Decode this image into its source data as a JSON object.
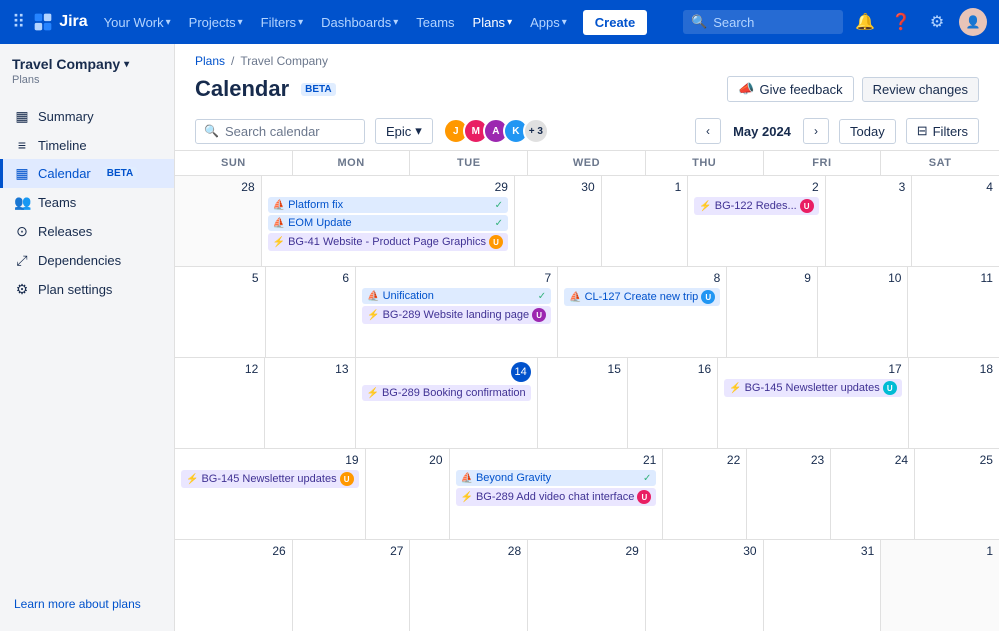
{
  "topNav": {
    "logoText": "Jira",
    "yourWork": "Your Work",
    "projects": "Projects",
    "filters": "Filters",
    "dashboards": "Dashboards",
    "teams": "Teams",
    "plans": "Plans",
    "apps": "Apps",
    "createLabel": "Create",
    "searchPlaceholder": "Search"
  },
  "breadcrumb": {
    "plans": "Plans",
    "company": "Travel Company"
  },
  "pageHeader": {
    "title": "Calendar",
    "beta": "BETA",
    "feedbackBtn": "Give feedback",
    "reviewBtn": "Review changes"
  },
  "toolbar": {
    "searchPlaceholder": "Search calendar",
    "epicLabel": "Epic",
    "monthLabel": "May 2024",
    "todayLabel": "Today",
    "filtersLabel": "Filters",
    "avatarCount": "+ 3"
  },
  "calendarHeader": {
    "days": [
      "SUN",
      "MON",
      "TUE",
      "WED",
      "THU",
      "FRI",
      "SAT"
    ]
  },
  "sidebar": {
    "projectName": "Travel Company",
    "projectSubLabel": "Plans",
    "items": [
      {
        "id": "summary",
        "label": "Summary",
        "icon": "▦"
      },
      {
        "id": "timeline",
        "label": "Timeline",
        "icon": "≡"
      },
      {
        "id": "calendar",
        "label": "Calendar",
        "icon": "▦",
        "beta": true,
        "active": true
      },
      {
        "id": "teams",
        "label": "Teams",
        "icon": "👥"
      },
      {
        "id": "releases",
        "label": "Releases",
        "icon": "⊙"
      },
      {
        "id": "dependencies",
        "label": "Dependencies",
        "icon": "⤢"
      },
      {
        "id": "plan-settings",
        "label": "Plan settings",
        "icon": "⚙"
      }
    ],
    "learnMore": "Learn more about plans"
  },
  "weeks": [
    {
      "days": [
        {
          "num": "28",
          "otherMonth": true,
          "events": []
        },
        {
          "num": "29",
          "events": [
            {
              "type": "blue",
              "icon": "🚢",
              "text": "Platform fix",
              "checks": true
            },
            {
              "type": "blue",
              "icon": "🚢",
              "text": "EOM Update",
              "checks": true
            },
            {
              "type": "purple",
              "icon": "⚡",
              "text": "BG-41 Website - Product Page Graphics",
              "hasAvatar": true
            }
          ]
        },
        {
          "num": "30",
          "events": []
        },
        {
          "num": "1",
          "events": []
        },
        {
          "num": "2",
          "events": [
            {
              "type": "purple",
              "icon": "⚡",
              "text": "BG-122 Redes...",
              "hasAvatar": true
            }
          ]
        },
        {
          "num": "3",
          "events": []
        },
        {
          "num": "4",
          "events": []
        }
      ]
    },
    {
      "days": [
        {
          "num": "5",
          "events": []
        },
        {
          "num": "6",
          "events": []
        },
        {
          "num": "7",
          "events": [
            {
              "type": "blue",
              "icon": "🚢",
              "text": "Unification",
              "checks": true
            },
            {
              "type": "purple",
              "icon": "⚡",
              "text": "BG-289 Website landing page",
              "hasAvatar": true
            }
          ]
        },
        {
          "num": "8",
          "events": [
            {
              "type": "blue",
              "icon": "🚢",
              "text": "CL-127 Create new trip",
              "hasAvatar": true
            }
          ]
        },
        {
          "num": "9",
          "events": []
        },
        {
          "num": "10",
          "events": []
        },
        {
          "num": "11",
          "events": []
        }
      ]
    },
    {
      "days": [
        {
          "num": "12",
          "events": []
        },
        {
          "num": "13",
          "events": []
        },
        {
          "num": "14",
          "today": true,
          "events": [
            {
              "type": "purple",
              "icon": "⚡",
              "text": "BG-289 Booking confirmation"
            }
          ]
        },
        {
          "num": "15",
          "events": []
        },
        {
          "num": "16",
          "events": []
        },
        {
          "num": "17",
          "events": [
            {
              "type": "purple",
              "icon": "⚡",
              "text": "BG-145 Newsletter updates",
              "hasAvatar": true
            }
          ]
        },
        {
          "num": "18",
          "events": []
        }
      ]
    },
    {
      "days": [
        {
          "num": "19",
          "events": [
            {
              "type": "purple",
              "icon": "⚡",
              "text": "BG-145 Newsletter updates",
              "hasAvatar": true
            }
          ]
        },
        {
          "num": "20",
          "events": []
        },
        {
          "num": "21",
          "events": [
            {
              "type": "blue",
              "icon": "🚢",
              "text": "Beyond Gravity",
              "checks": true
            },
            {
              "type": "purple",
              "icon": "⚡",
              "text": "BG-289 Add video chat interface",
              "hasAvatar": true
            }
          ]
        },
        {
          "num": "22",
          "events": []
        },
        {
          "num": "23",
          "events": []
        },
        {
          "num": "24",
          "events": []
        },
        {
          "num": "25",
          "events": []
        }
      ]
    },
    {
      "days": [
        {
          "num": "26",
          "events": []
        },
        {
          "num": "27",
          "events": []
        },
        {
          "num": "28",
          "events": []
        },
        {
          "num": "29",
          "events": []
        },
        {
          "num": "30",
          "events": []
        },
        {
          "num": "31",
          "events": []
        },
        {
          "num": "1",
          "otherMonth": true,
          "events": []
        }
      ]
    }
  ]
}
